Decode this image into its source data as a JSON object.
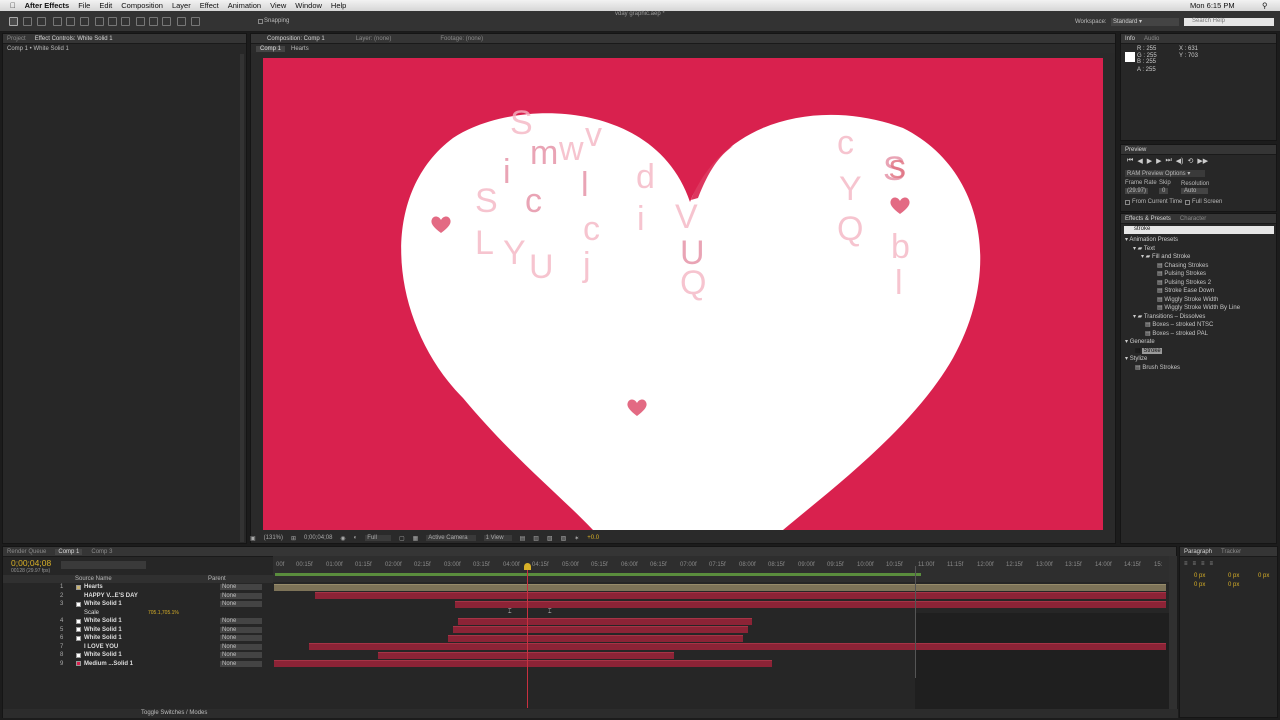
{
  "menubar": {
    "app": "After Effects",
    "items": [
      "File",
      "Edit",
      "Composition",
      "Layer",
      "Effect",
      "Animation",
      "View",
      "Window",
      "Help"
    ],
    "clock": "Mon 6:15 PM"
  },
  "toolbar": {
    "snapping": "Snapping",
    "file_title": "vday graphic.aep *",
    "workspace_label": "Workspace:",
    "workspace_value": "Standard",
    "search_placeholder": "Search Help"
  },
  "left_panel": {
    "tabs": [
      "Project",
      "Effect Controls: White Solid 1"
    ],
    "breadcrumb": "Comp 1 • White Solid 1"
  },
  "comp_panel": {
    "tabs": [
      "Composition: Comp 1",
      "Layer: (none)",
      "Footage: (none)"
    ],
    "subtabs": [
      "Comp 1",
      "Hearts"
    ],
    "letters": [
      "S",
      "m",
      "w",
      "v",
      "c",
      "S",
      "i",
      "l",
      "d",
      "Y",
      "S",
      "c",
      "c",
      "Q",
      "b",
      "L",
      "Y",
      "U",
      "U",
      "Q",
      "V",
      "i",
      "j",
      "l",
      "s"
    ],
    "footer": {
      "zoom": "(131%)",
      "timecode": "0;00;04;08",
      "resolution": "Full",
      "camera": "Active Camera",
      "views": "1 View",
      "exposure": "+0.0"
    }
  },
  "info": {
    "tabs": [
      "Info",
      "Audio"
    ],
    "r": "R : 255",
    "g": "G : 255",
    "b": "B : 255",
    "a": "A : 255",
    "x": "X : 631",
    "y": "Y : 703"
  },
  "preview": {
    "tab": "Preview",
    "ram_options": "RAM Preview Options",
    "frame_rate_label": "Frame Rate",
    "skip_label": "Skip",
    "resolution_label": "Resolution",
    "frame_rate": "(29.97)",
    "skip": "0",
    "resolution": "Auto",
    "from_current": "From Current Time",
    "full_screen": "Full Screen"
  },
  "effects": {
    "tabs": [
      "Effects & Presets",
      "Character"
    ],
    "search_value": "stroke",
    "tree": [
      {
        "label": "Animation Presets",
        "indent": 1,
        "type": "folder"
      },
      {
        "label": "Text",
        "indent": 2,
        "type": "folder"
      },
      {
        "label": "Fill and Stroke",
        "indent": 3,
        "type": "folder"
      },
      {
        "label": "Chasing Strokes",
        "indent": 4,
        "type": "leaf"
      },
      {
        "label": "Pulsing Strokes",
        "indent": 4,
        "type": "leaf"
      },
      {
        "label": "Pulsing Strokes 2",
        "indent": 4,
        "type": "leaf"
      },
      {
        "label": "Stroke Ease Down",
        "indent": 4,
        "type": "leaf"
      },
      {
        "label": "Wiggly Stroke Width",
        "indent": 4,
        "type": "leaf"
      },
      {
        "label": "Wiggly Stroke Width By Line",
        "indent": 4,
        "type": "leaf"
      },
      {
        "label": "Transitions – Dissolves",
        "indent": 2,
        "type": "folder"
      },
      {
        "label": "Boxes – stroked NTSC",
        "indent": 3,
        "type": "leaf"
      },
      {
        "label": "Boxes – stroked PAL",
        "indent": 3,
        "type": "leaf"
      },
      {
        "label": "Generate",
        "indent": 0,
        "type": "folder"
      },
      {
        "label": "Stroke",
        "indent": 1,
        "type": "leaf",
        "selected": true
      },
      {
        "label": "Stylize",
        "indent": 0,
        "type": "folder"
      },
      {
        "label": "Brush Strokes",
        "indent": 1,
        "type": "leaf"
      }
    ]
  },
  "timeline": {
    "tabs": [
      "Render Queue",
      "Comp 1",
      "Comp 3"
    ],
    "timecode": "0;00;04;08",
    "frames": "00128 (29.97 fps)",
    "col_source": "Source Name",
    "col_parent": "Parent",
    "layers": [
      {
        "num": "1",
        "name": "Hearts",
        "parent": "None",
        "color": "#c9b270"
      },
      {
        "num": "2",
        "name": "HAPPY V...E'S DAY",
        "parent": "None",
        "color": "#c43c55"
      },
      {
        "num": "3",
        "name": "White Solid 1",
        "parent": "None",
        "color": "#c43c55"
      },
      {
        "num": "",
        "name": "Scale",
        "parent": "",
        "color": ""
      },
      {
        "num": "4",
        "name": "White Solid 1",
        "parent": "None",
        "color": "#c43c55"
      },
      {
        "num": "5",
        "name": "White Solid 1",
        "parent": "None",
        "color": "#c43c55"
      },
      {
        "num": "6",
        "name": "White Solid 1",
        "parent": "None",
        "color": "#c43c55"
      },
      {
        "num": "7",
        "name": "I LOVE YOU",
        "parent": "None",
        "color": "#c43c55"
      },
      {
        "num": "8",
        "name": "White Solid 1",
        "parent": "None",
        "color": "#c43c55"
      },
      {
        "num": "9",
        "name": "Medium ...Solid 1",
        "parent": "None",
        "color": "#c43c55"
      }
    ],
    "scale_value": "705.1,705.1%",
    "ruler": [
      "00f",
      "00:15f",
      "01:00f",
      "01:15f",
      "02:00f",
      "02:15f",
      "03:00f",
      "03:15f",
      "04:00f",
      "04:15f",
      "05:00f",
      "05:15f",
      "06:00f",
      "06:15f",
      "07:00f",
      "07:15f",
      "08:00f",
      "08:15f",
      "09:00f",
      "09:15f",
      "10:00f",
      "10:15f",
      "11:00f",
      "11:15f",
      "12:00f",
      "12:15f",
      "13:00f",
      "13:15f",
      "14:00f",
      "14:15f",
      "15:"
    ],
    "footer": "Toggle Switches / Modes"
  },
  "paragraph": {
    "tabs": [
      "Paragraph",
      "Tracker"
    ],
    "values": [
      "0 px",
      "0 px",
      "0 px",
      "0 px",
      "0 px"
    ]
  }
}
